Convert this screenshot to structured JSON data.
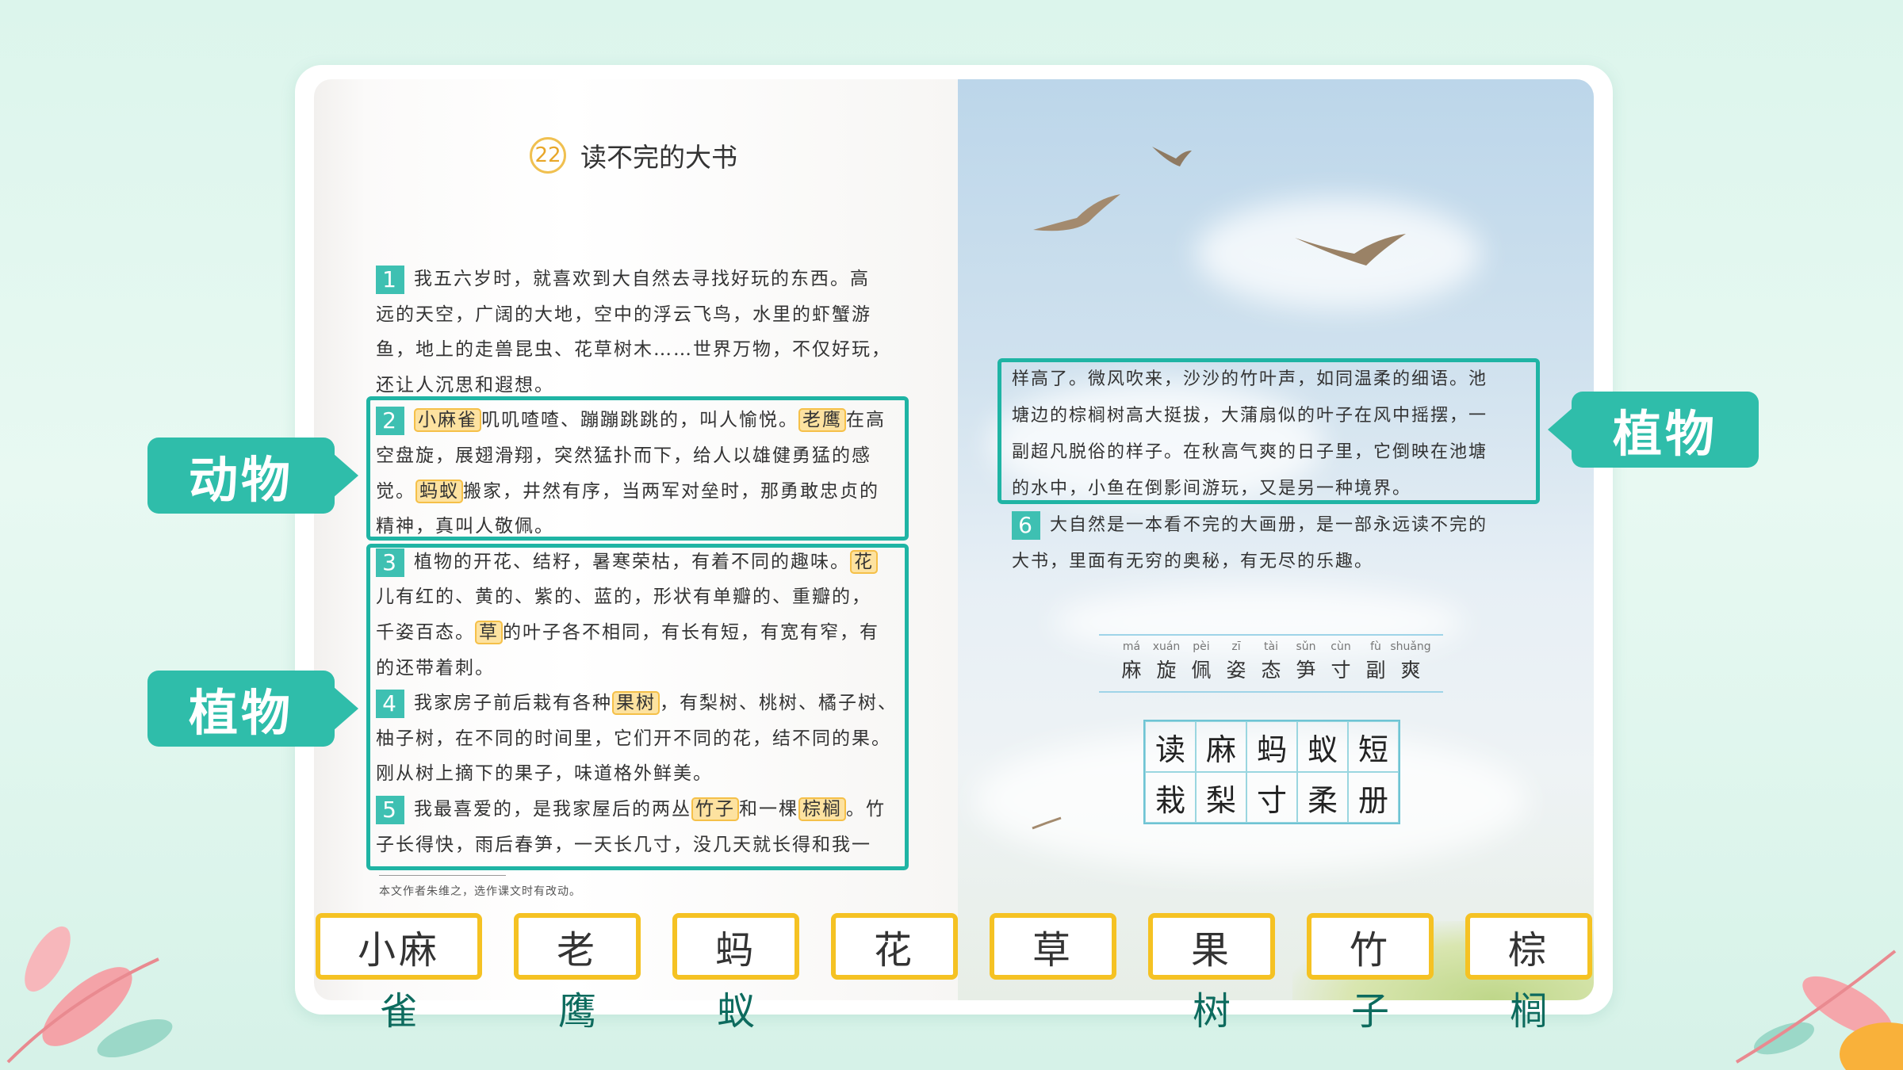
{
  "lesson": {
    "number": "22",
    "title": "读不完的大书"
  },
  "paragraphs": [
    {
      "num": "1",
      "lines": [
        [
          {
            "t": "我五六岁时，就喜欢到大自然去寻找好玩的东西。高"
          }
        ],
        [
          {
            "t": "远的天空，广阔的大地，空中的浮云飞鸟，水里的虾蟹游"
          }
        ],
        [
          {
            "t": "鱼，地上的走兽昆虫、花草树木……世界万物，不仅好玩，"
          }
        ],
        [
          {
            "t": "还让人沉思和遐想。"
          }
        ]
      ]
    },
    {
      "num": "2",
      "lines": [
        [
          {
            "t": "小麻雀",
            "h": true
          },
          {
            "t": "叽叽喳喳、蹦蹦跳跳的，叫人愉悦。"
          },
          {
            "t": "老鹰",
            "h": true
          },
          {
            "t": "在高"
          }
        ],
        [
          {
            "t": "空盘旋，展翅滑翔，突然猛扑而下，给人以雄健勇猛的感"
          }
        ],
        [
          {
            "t": "觉。"
          },
          {
            "t": "蚂蚁",
            "h": true
          },
          {
            "t": "搬家，井然有序，当两军对垒时，那勇敢忠贞的"
          }
        ],
        [
          {
            "t": "精神，真叫人敬佩。"
          }
        ]
      ]
    },
    {
      "num": "3",
      "lines": [
        [
          {
            "t": "植物的开花、结籽，暑寒荣枯，有着不同的趣味。"
          },
          {
            "t": "花",
            "h": true
          }
        ],
        [
          {
            "t": "儿有红的、黄的、紫的、蓝的，形状有单瓣的、重瓣的，"
          }
        ],
        [
          {
            "t": "千姿百态。"
          },
          {
            "t": "草",
            "h": true
          },
          {
            "t": "的叶子各不相同，有长有短，有宽有窄，有"
          }
        ],
        [
          {
            "t": "的还带着刺。"
          }
        ]
      ]
    },
    {
      "num": "4",
      "lines": [
        [
          {
            "t": "我家房子前后栽有各种"
          },
          {
            "t": "果树",
            "h": true
          },
          {
            "t": "，有梨树、桃树、橘子树、"
          }
        ],
        [
          {
            "t": "柚子树，在不同的时间里，它们开不同的花，结不同的果。"
          }
        ],
        [
          {
            "t": "刚从树上摘下的果子，味道格外鲜美。"
          }
        ]
      ]
    },
    {
      "num": "5",
      "lines": [
        [
          {
            "t": "我最喜爱的，是我家屋后的两丛"
          },
          {
            "t": "竹子",
            "h": true
          },
          {
            "t": "和一棵"
          },
          {
            "t": "棕榈",
            "h": true
          },
          {
            "t": "。竹"
          }
        ],
        [
          {
            "t": "子长得快，雨后春笋，一天长几寸，没几天就长得和我一"
          }
        ]
      ]
    }
  ],
  "right_text": [
    "样高了。微风吹来，沙沙的竹叶声，如同温柔的细语。池",
    "塘边的棕榈树高大挺拔，大蒲扇似的叶子在风中摇摆，一",
    "副超凡脱俗的样子。在秋高气爽的日子里，它倒映在池塘",
    "的水中，小鱼在倒影间游玩，又是另一种境界。"
  ],
  "para6": {
    "num": "6",
    "lines": [
      "大自然是一本看不完的大画册，是一部永远读不完的",
      "大书，里面有无穷的奥秘，有无尽的乐趣。"
    ]
  },
  "footnote": "本文作者朱维之，选作课文时有改动。",
  "labels": {
    "animals_left": "动物",
    "plants_left": "植物",
    "plants_right": "植物"
  },
  "pinyin_words": [
    {
      "py": "má",
      "hz": "麻"
    },
    {
      "py": "xuán",
      "hz": "旋"
    },
    {
      "py": "pèi",
      "hz": "佩"
    },
    {
      "py": "zī",
      "hz": "姿"
    },
    {
      "py": "tài",
      "hz": "态"
    },
    {
      "py": "sǔn",
      "hz": "笋"
    },
    {
      "py": "cùn",
      "hz": "寸"
    },
    {
      "py": "fù",
      "hz": "副"
    },
    {
      "py": "shuǎng",
      "hz": "爽"
    }
  ],
  "write_chars": [
    "读",
    "麻",
    "蚂",
    "蚁",
    "短",
    "栽",
    "梨",
    "寸",
    "柔",
    "册"
  ],
  "word_cards": [
    {
      "card": "小麻",
      "over": "雀"
    },
    {
      "card": "老",
      "over": "鹰"
    },
    {
      "card": "蚂",
      "over": "蚁"
    },
    {
      "card": "花",
      "over": ""
    },
    {
      "card": "草",
      "over": ""
    },
    {
      "card": "果",
      "over": "树"
    },
    {
      "card": "竹",
      "over": "子"
    },
    {
      "card": "棕",
      "over": "榈"
    }
  ],
  "colors": {
    "teal": "#1fb4a4",
    "label": "#2fbdaa",
    "highlight": "#fde2a0",
    "card_border": "#f5c223"
  }
}
